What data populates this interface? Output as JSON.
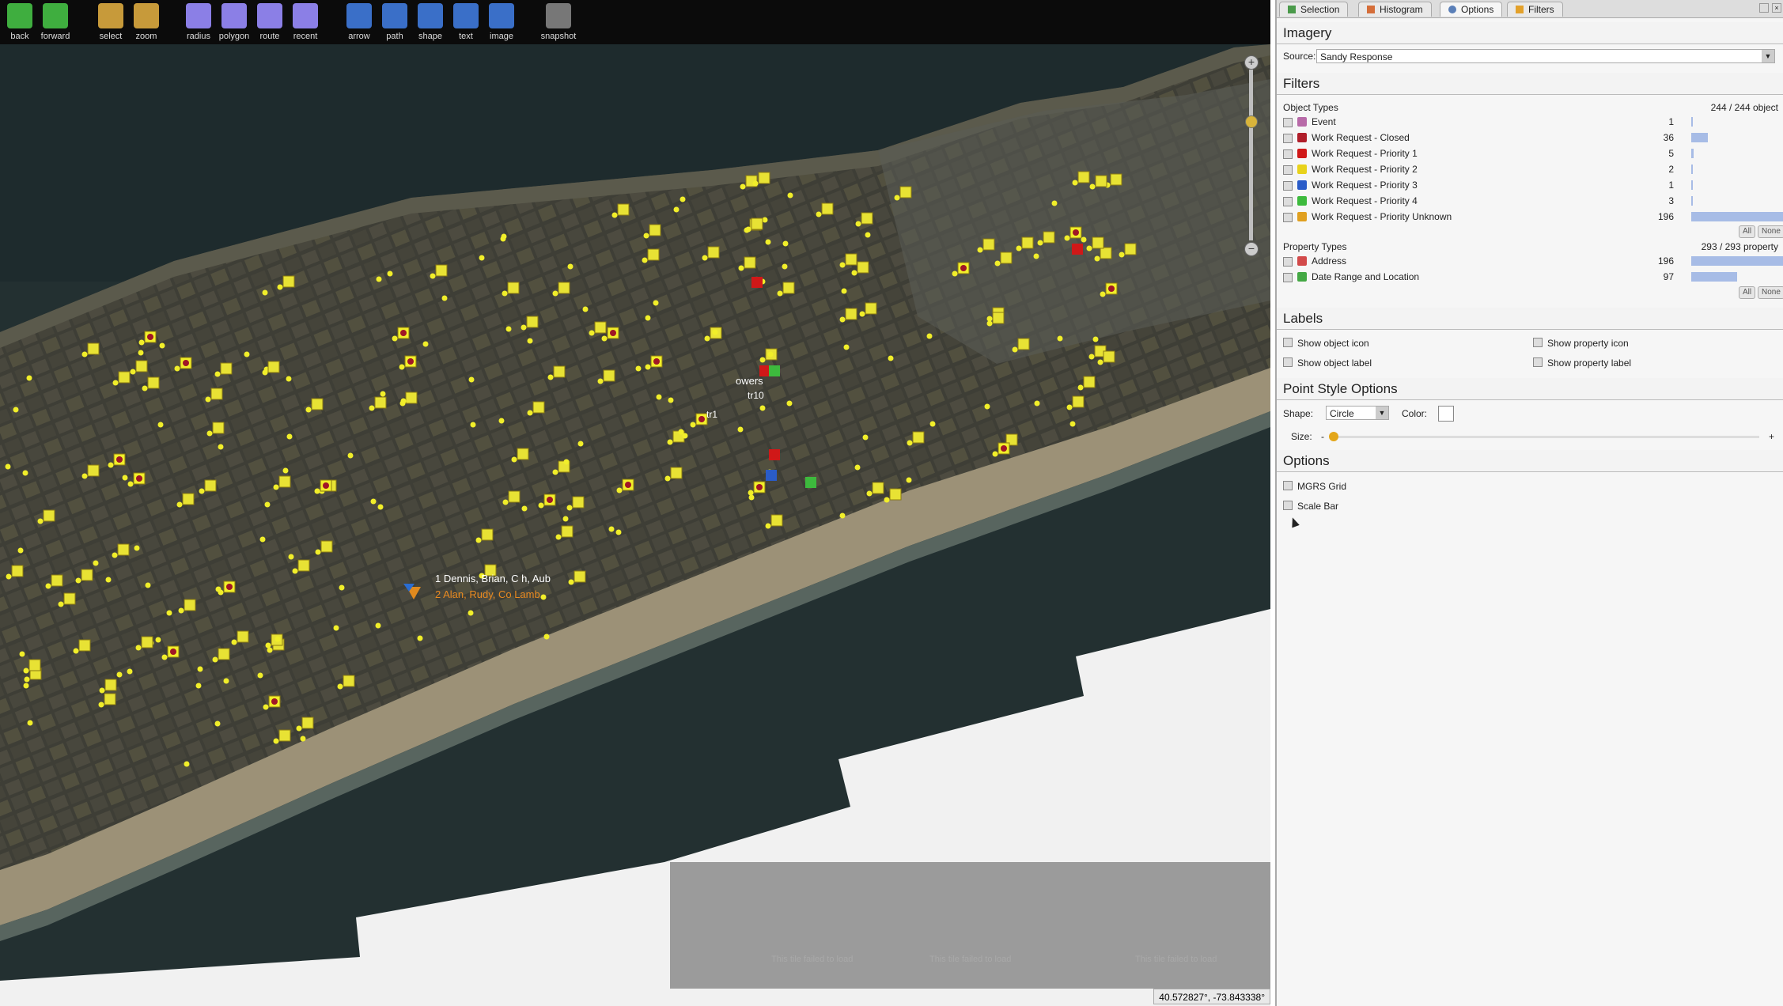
{
  "toolbar": {
    "tools": [
      {
        "label": "back",
        "icon": "back-arrow-icon"
      },
      {
        "label": "forward",
        "icon": "forward-arrow-icon"
      },
      {
        "label": "select",
        "icon": "select-icon"
      },
      {
        "label": "zoom",
        "icon": "zoom-icon"
      },
      {
        "label": "radius",
        "icon": "radius-icon"
      },
      {
        "label": "polygon",
        "icon": "polygon-icon"
      },
      {
        "label": "route",
        "icon": "route-icon"
      },
      {
        "label": "recent",
        "icon": "recent-icon"
      },
      {
        "label": "arrow",
        "icon": "arrow-pen-icon"
      },
      {
        "label": "path",
        "icon": "path-pen-icon"
      },
      {
        "label": "shape",
        "icon": "shape-pen-icon"
      },
      {
        "label": "text",
        "icon": "text-pen-icon"
      },
      {
        "label": "image",
        "icon": "image-pen-icon"
      },
      {
        "label": "snapshot",
        "icon": "camera-icon"
      }
    ]
  },
  "map": {
    "labels": {
      "towers": "owers",
      "tr10a": "tr10",
      "tr1": "tr1",
      "team1": "1 Dennis, Brian, C   h, Aub",
      "team2": "2 Alan, Rudy, Co     Lamb"
    },
    "tile_text": "This tile failed to load",
    "coordinates": "40.572827°, -73.843338°"
  },
  "tabs": [
    "Selection",
    "Histogram",
    "Options",
    "Filters"
  ],
  "imagery": {
    "header": "Imagery",
    "source_label": "Source:",
    "source_value": "Sandy Response"
  },
  "filters": {
    "header": "Filters",
    "object_types_label": "Object Types",
    "object_types_count": "244 / 244 object",
    "object_types": [
      {
        "label": "Event",
        "count": "1",
        "fraction": 0.005,
        "icon_color": "#b86aa8"
      },
      {
        "label": "Work Request - Closed",
        "count": "36",
        "fraction": 0.18,
        "icon_color": "#b01e2a"
      },
      {
        "label": "Work Request - Priority 1",
        "count": "5",
        "fraction": 0.025,
        "icon_color": "#d01818"
      },
      {
        "label": "Work Request - Priority 2",
        "count": "2",
        "fraction": 0.01,
        "icon_color": "#e8d21a"
      },
      {
        "label": "Work Request - Priority 3",
        "count": "1",
        "fraction": 0.005,
        "icon_color": "#2a5cc8"
      },
      {
        "label": "Work Request - Priority 4",
        "count": "3",
        "fraction": 0.015,
        "icon_color": "#3dba3d"
      },
      {
        "label": "Work Request - Priority Unknown",
        "count": "196",
        "fraction": 1.0,
        "icon_color": "#e0a020"
      }
    ],
    "all_label": "All",
    "none_label": "None",
    "property_types_label": "Property Types",
    "property_types_count": "293 / 293 property",
    "property_types": [
      {
        "label": "Address",
        "count": "196",
        "fraction": 1.0,
        "icon_color": "#d24a4a"
      },
      {
        "label": "Date Range and Location",
        "count": "97",
        "fraction": 0.49,
        "icon_color": "#44a844"
      }
    ]
  },
  "labels_section": {
    "header": "Labels",
    "show_object_icon": "Show object icon",
    "show_property_icon": "Show property icon",
    "show_object_label": "Show object label",
    "show_property_label": "Show property label"
  },
  "point_style": {
    "header": "Point Style Options",
    "shape_label": "Shape:",
    "shape_value": "Circle",
    "color_label": "Color:",
    "size_label": "Size:",
    "size_minus": "-",
    "size_plus": "+"
  },
  "options": {
    "header": "Options",
    "mgrs": "MGRS Grid",
    "scale_bar": "Scale Bar"
  }
}
